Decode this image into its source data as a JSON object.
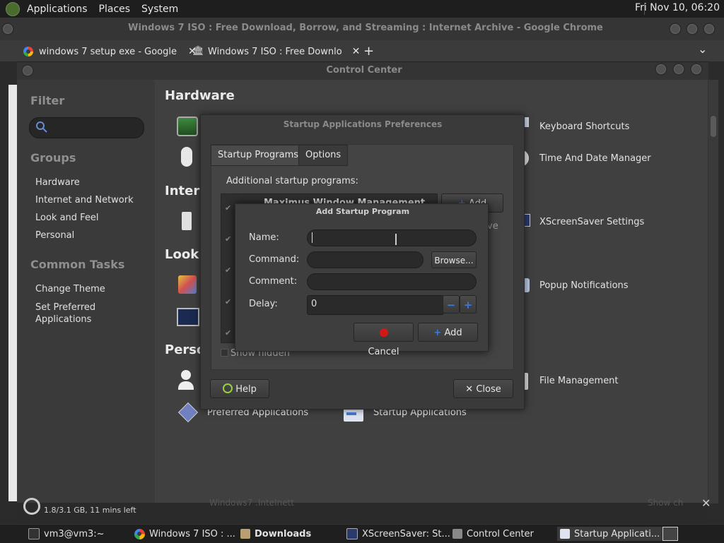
{
  "top_panel": {
    "menus": [
      "Applications",
      "Places",
      "System"
    ],
    "clock": "Fri Nov 10, 06:20"
  },
  "chrome": {
    "title": "Windows 7 ISO : Free Download, Borrow, and Streaming : Internet Archive - Google Chrome",
    "tabs": [
      {
        "label": "windows 7 setup exe - Google"
      },
      {
        "label": "Windows 7 ISO : Free Downlo"
      }
    ],
    "close_glyph": "✕",
    "new_tab": "+",
    "tab_menu": "⌄"
  },
  "control_center": {
    "title": "Control Center",
    "filter_label": "Filter",
    "groups_label": "Groups",
    "groups": [
      "Hardware",
      "Internet and Network",
      "Look and Feel",
      "Personal"
    ],
    "common_tasks_label": "Common Tasks",
    "tasks": [
      "Change Theme",
      "Set Preferred\nApplications"
    ],
    "sections": {
      "hardware": "Hardware",
      "internet": "Intern",
      "look": "Look a",
      "personal": "Perso"
    },
    "items_right": [
      "Keyboard Shortcuts",
      "Time And Date Manager",
      "XScreenSaver Settings",
      "Popup Notifications",
      "File Management"
    ],
    "items_bottom": [
      "Preferred Applications",
      "Startup Applications"
    ]
  },
  "startup_prefs": {
    "title": "Startup Applications Preferences",
    "tabs": [
      "Startup Programs",
      "Options"
    ],
    "additional_label": "Additional startup programs:",
    "first_row": "Maximus Window Management",
    "add_button": "Add",
    "remove_partial": "ve",
    "show_hidden": "Show hidden",
    "help_button": "Help",
    "close_button": "Close"
  },
  "add_startup": {
    "title": "Add Startup Program",
    "name_label": "Name:",
    "name_value": "",
    "command_label": "Command:",
    "command_value": "",
    "browse_button": "Browse...",
    "comment_label": "Comment:",
    "comment_value": "",
    "delay_label": "Delay:",
    "delay_value": "0",
    "cancel_button": "Cancel",
    "add_button": "Add",
    "minus": "−",
    "plus": "+"
  },
  "status": {
    "memory": "1.8/3.1 GB, 11 mins left",
    "hidden_partial": "Windows7 .InteInett",
    "show_partial": "Show ch"
  },
  "taskbar": {
    "items": [
      "vm3@vm3:~",
      "Windows 7 ISO : ...",
      "Downloads",
      "XScreenSaver: St...",
      "Control Center",
      "Startup Applicati..."
    ]
  },
  "colors": {
    "accent_blue": "#3d7ad6",
    "cancel_red": "#d01818",
    "help_green": "#9ad040"
  }
}
